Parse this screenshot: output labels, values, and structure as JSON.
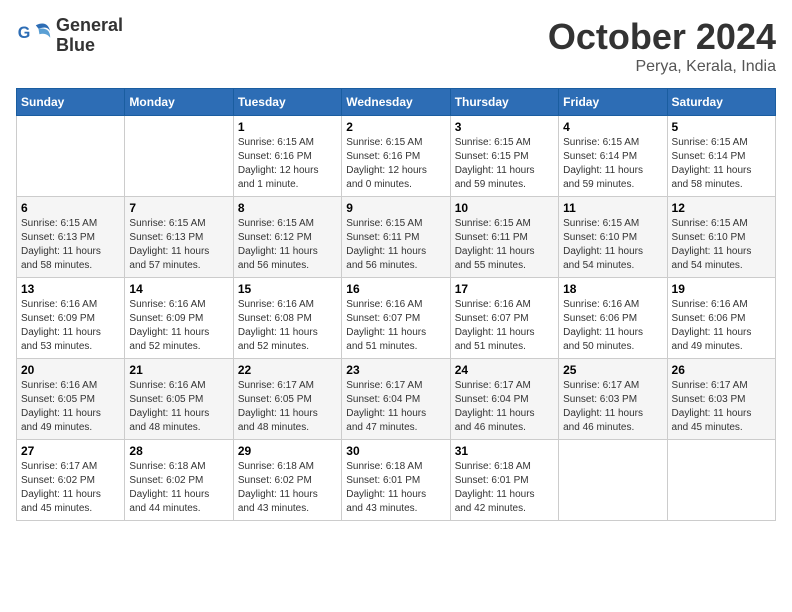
{
  "logo": {
    "name1": "General",
    "name2": "Blue"
  },
  "title": "October 2024",
  "subtitle": "Perya, Kerala, India",
  "headers": [
    "Sunday",
    "Monday",
    "Tuesday",
    "Wednesday",
    "Thursday",
    "Friday",
    "Saturday"
  ],
  "weeks": [
    [
      {
        "day": "",
        "detail": ""
      },
      {
        "day": "",
        "detail": ""
      },
      {
        "day": "1",
        "detail": "Sunrise: 6:15 AM\nSunset: 6:16 PM\nDaylight: 12 hours\nand 1 minute."
      },
      {
        "day": "2",
        "detail": "Sunrise: 6:15 AM\nSunset: 6:16 PM\nDaylight: 12 hours\nand 0 minutes."
      },
      {
        "day": "3",
        "detail": "Sunrise: 6:15 AM\nSunset: 6:15 PM\nDaylight: 11 hours\nand 59 minutes."
      },
      {
        "day": "4",
        "detail": "Sunrise: 6:15 AM\nSunset: 6:14 PM\nDaylight: 11 hours\nand 59 minutes."
      },
      {
        "day": "5",
        "detail": "Sunrise: 6:15 AM\nSunset: 6:14 PM\nDaylight: 11 hours\nand 58 minutes."
      }
    ],
    [
      {
        "day": "6",
        "detail": "Sunrise: 6:15 AM\nSunset: 6:13 PM\nDaylight: 11 hours\nand 58 minutes."
      },
      {
        "day": "7",
        "detail": "Sunrise: 6:15 AM\nSunset: 6:13 PM\nDaylight: 11 hours\nand 57 minutes."
      },
      {
        "day": "8",
        "detail": "Sunrise: 6:15 AM\nSunset: 6:12 PM\nDaylight: 11 hours\nand 56 minutes."
      },
      {
        "day": "9",
        "detail": "Sunrise: 6:15 AM\nSunset: 6:11 PM\nDaylight: 11 hours\nand 56 minutes."
      },
      {
        "day": "10",
        "detail": "Sunrise: 6:15 AM\nSunset: 6:11 PM\nDaylight: 11 hours\nand 55 minutes."
      },
      {
        "day": "11",
        "detail": "Sunrise: 6:15 AM\nSunset: 6:10 PM\nDaylight: 11 hours\nand 54 minutes."
      },
      {
        "day": "12",
        "detail": "Sunrise: 6:15 AM\nSunset: 6:10 PM\nDaylight: 11 hours\nand 54 minutes."
      }
    ],
    [
      {
        "day": "13",
        "detail": "Sunrise: 6:16 AM\nSunset: 6:09 PM\nDaylight: 11 hours\nand 53 minutes."
      },
      {
        "day": "14",
        "detail": "Sunrise: 6:16 AM\nSunset: 6:09 PM\nDaylight: 11 hours\nand 52 minutes."
      },
      {
        "day": "15",
        "detail": "Sunrise: 6:16 AM\nSunset: 6:08 PM\nDaylight: 11 hours\nand 52 minutes."
      },
      {
        "day": "16",
        "detail": "Sunrise: 6:16 AM\nSunset: 6:07 PM\nDaylight: 11 hours\nand 51 minutes."
      },
      {
        "day": "17",
        "detail": "Sunrise: 6:16 AM\nSunset: 6:07 PM\nDaylight: 11 hours\nand 51 minutes."
      },
      {
        "day": "18",
        "detail": "Sunrise: 6:16 AM\nSunset: 6:06 PM\nDaylight: 11 hours\nand 50 minutes."
      },
      {
        "day": "19",
        "detail": "Sunrise: 6:16 AM\nSunset: 6:06 PM\nDaylight: 11 hours\nand 49 minutes."
      }
    ],
    [
      {
        "day": "20",
        "detail": "Sunrise: 6:16 AM\nSunset: 6:05 PM\nDaylight: 11 hours\nand 49 minutes."
      },
      {
        "day": "21",
        "detail": "Sunrise: 6:16 AM\nSunset: 6:05 PM\nDaylight: 11 hours\nand 48 minutes."
      },
      {
        "day": "22",
        "detail": "Sunrise: 6:17 AM\nSunset: 6:05 PM\nDaylight: 11 hours\nand 48 minutes."
      },
      {
        "day": "23",
        "detail": "Sunrise: 6:17 AM\nSunset: 6:04 PM\nDaylight: 11 hours\nand 47 minutes."
      },
      {
        "day": "24",
        "detail": "Sunrise: 6:17 AM\nSunset: 6:04 PM\nDaylight: 11 hours\nand 46 minutes."
      },
      {
        "day": "25",
        "detail": "Sunrise: 6:17 AM\nSunset: 6:03 PM\nDaylight: 11 hours\nand 46 minutes."
      },
      {
        "day": "26",
        "detail": "Sunrise: 6:17 AM\nSunset: 6:03 PM\nDaylight: 11 hours\nand 45 minutes."
      }
    ],
    [
      {
        "day": "27",
        "detail": "Sunrise: 6:17 AM\nSunset: 6:02 PM\nDaylight: 11 hours\nand 45 minutes."
      },
      {
        "day": "28",
        "detail": "Sunrise: 6:18 AM\nSunset: 6:02 PM\nDaylight: 11 hours\nand 44 minutes."
      },
      {
        "day": "29",
        "detail": "Sunrise: 6:18 AM\nSunset: 6:02 PM\nDaylight: 11 hours\nand 43 minutes."
      },
      {
        "day": "30",
        "detail": "Sunrise: 6:18 AM\nSunset: 6:01 PM\nDaylight: 11 hours\nand 43 minutes."
      },
      {
        "day": "31",
        "detail": "Sunrise: 6:18 AM\nSunset: 6:01 PM\nDaylight: 11 hours\nand 42 minutes."
      },
      {
        "day": "",
        "detail": ""
      },
      {
        "day": "",
        "detail": ""
      }
    ]
  ]
}
